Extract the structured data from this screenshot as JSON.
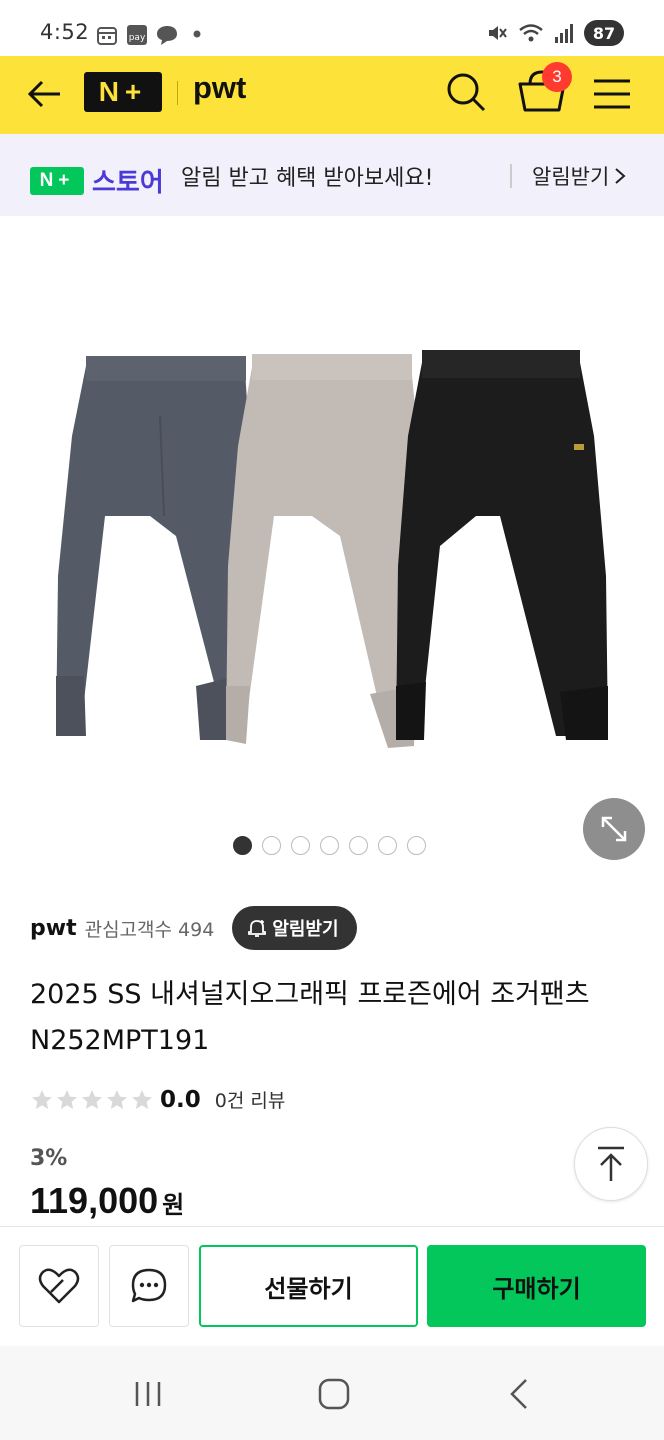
{
  "status_bar": {
    "time": "4:52",
    "battery": "87",
    "icons": [
      "calendar-icon",
      "pay-icon",
      "chat-bubble-icon",
      "dot-icon",
      "mute-icon",
      "wifi-icon",
      "signal-icon"
    ]
  },
  "header": {
    "logo_text": "N+",
    "title": "pwt",
    "cart_count": "3",
    "icons": [
      "back-arrow-icon",
      "search-icon",
      "cart-icon",
      "menu-icon"
    ],
    "bg_color": "#fde23a"
  },
  "promo": {
    "logo_badge": "N+",
    "logo_text": "스토어",
    "message": "알림 받고 혜택 받아보세요!",
    "action": "알림받기"
  },
  "gallery": {
    "image_alt": "three jogger pants in charcoal, beige and black",
    "total_dots": 7,
    "active_index": 0
  },
  "seller": {
    "name": "pwt",
    "fans_label": "관심고객수 494",
    "alert_chip": "알림받기"
  },
  "product": {
    "title": "2025 SS 내셔널지오그래픽 프로즌에어 조거팬츠 N252MPT191",
    "rating": "0.0",
    "reviews": "0건 리뷰",
    "star_count": 5,
    "discount": "3%",
    "price": "119,000",
    "currency": "원"
  },
  "actions": {
    "gift": "선물하기",
    "buy": "구매하기"
  },
  "colors": {
    "accent_green": "#03c75a",
    "brand_yellow": "#fde23a",
    "store_purple": "#4a3bd6",
    "badge_red": "#ff3b30"
  }
}
